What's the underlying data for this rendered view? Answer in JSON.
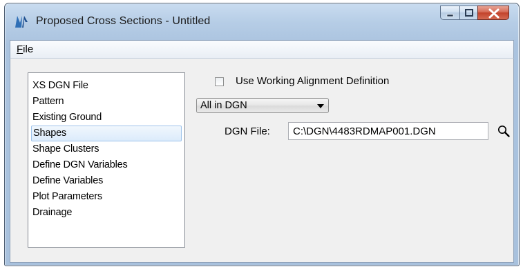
{
  "window": {
    "title": "Proposed Cross Sections - Untitled",
    "icons": {
      "app": "ms-logo-icon",
      "minimize": "minimize-icon",
      "maximize": "maximize-icon",
      "close": "close-icon"
    }
  },
  "menu": {
    "file_label": "File",
    "file_accel": "F",
    "file_rest": "ile"
  },
  "nav": {
    "items": [
      {
        "label": "XS DGN File",
        "selected": false
      },
      {
        "label": "Pattern",
        "selected": false
      },
      {
        "label": "Existing Ground",
        "selected": false
      },
      {
        "label": "Shapes",
        "selected": true
      },
      {
        "label": "Shape Clusters",
        "selected": false
      },
      {
        "label": "Define DGN Variables",
        "selected": false
      },
      {
        "label": "Define Variables",
        "selected": false
      },
      {
        "label": "Plot Parameters",
        "selected": false
      },
      {
        "label": "Drainage",
        "selected": false
      }
    ]
  },
  "shapes_panel": {
    "working_alignment": {
      "label": "Use Working Alignment Definition",
      "checked": false
    },
    "source_select": {
      "value": "All in DGN"
    },
    "dgn_file": {
      "label": "DGN File:",
      "value": "C:\\DGN\\4483RDMAP001.DGN",
      "browse_icon": "search-icon"
    }
  },
  "colors": {
    "selection_fill": "#dcebfb",
    "selection_border": "#9dc2ea",
    "close_button": "#c2422b",
    "frame": "#aac3df"
  }
}
